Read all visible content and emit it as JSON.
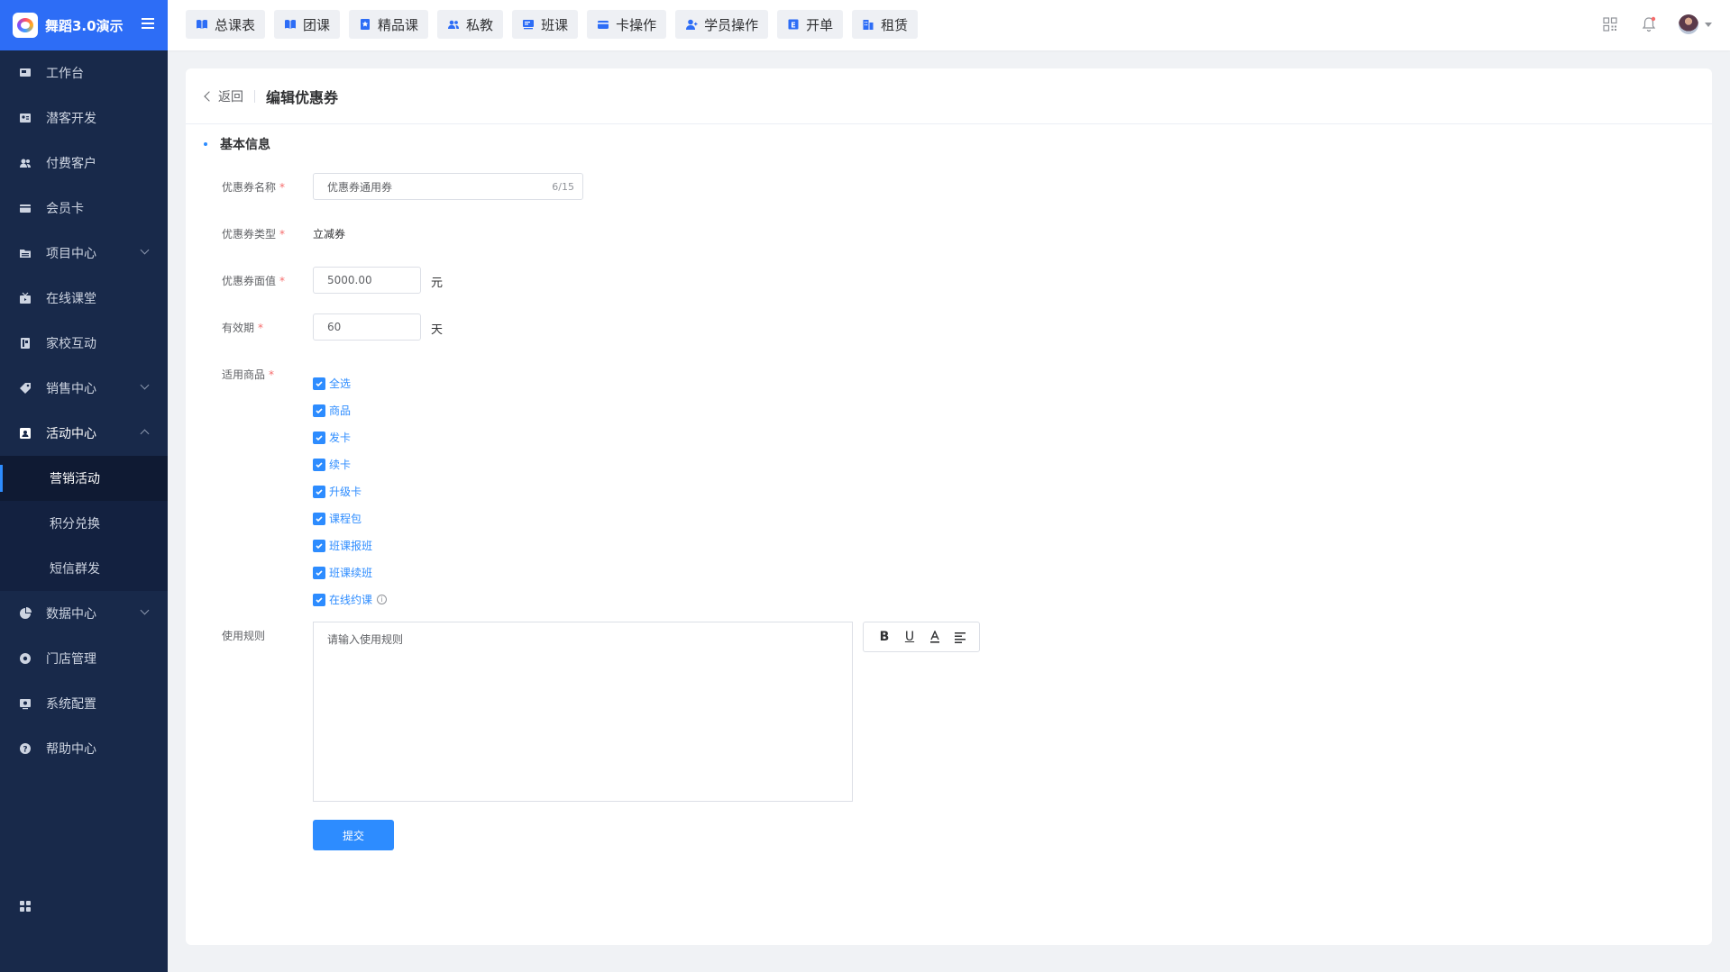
{
  "app": {
    "name": "舞蹈3.0演示"
  },
  "sidebar": {
    "items": [
      {
        "label": "工作台",
        "icon": "monitor-icon"
      },
      {
        "label": "潜客开发",
        "icon": "contact-card-icon"
      },
      {
        "label": "付费客户",
        "icon": "users-icon"
      },
      {
        "label": "会员卡",
        "icon": "card-icon"
      },
      {
        "label": "项目中心",
        "icon": "folder-icon"
      },
      {
        "label": "在线课堂",
        "icon": "tv-icon"
      },
      {
        "label": "家校互动",
        "icon": "book-icon"
      },
      {
        "label": "销售中心",
        "icon": "tag-icon"
      },
      {
        "label": "活动中心",
        "icon": "activity-icon"
      },
      {
        "label": "营销活动"
      },
      {
        "label": "积分兑换"
      },
      {
        "label": "短信群发"
      },
      {
        "label": "数据中心",
        "icon": "pie-chart-icon"
      },
      {
        "label": "门店管理",
        "icon": "store-icon"
      },
      {
        "label": "系统配置",
        "icon": "settings-icon"
      },
      {
        "label": "帮助中心",
        "icon": "help-icon"
      }
    ]
  },
  "topbar": {
    "tabs": [
      {
        "label": "总课表",
        "icon": "book-open-icon"
      },
      {
        "label": "团课",
        "icon": "book-open-icon"
      },
      {
        "label": "精品课",
        "icon": "star-book-icon"
      },
      {
        "label": "私教",
        "icon": "users-icon"
      },
      {
        "label": "班课",
        "icon": "board-icon"
      },
      {
        "label": "卡操作",
        "icon": "card-icon"
      },
      {
        "label": "学员操作",
        "icon": "user-icon"
      },
      {
        "label": "开单",
        "icon": "receipt-icon"
      },
      {
        "label": "租赁",
        "icon": "building-icon"
      }
    ]
  },
  "page": {
    "back_label": "返回",
    "title": "编辑优惠券",
    "section_title": "基本信息"
  },
  "form": {
    "name": {
      "label": "优惠券名称",
      "value": "优惠券通用券",
      "counter": "6/15"
    },
    "type": {
      "label": "优惠券类型",
      "value": "立减券"
    },
    "face_value": {
      "label": "优惠券面值",
      "value": "5000.00",
      "unit": "元"
    },
    "validity": {
      "label": "有效期",
      "value": "60",
      "unit": "天"
    },
    "products": {
      "label": "适用商品",
      "options": [
        "全选",
        "商品",
        "发卡",
        "续卡",
        "升级卡",
        "课程包",
        "班课报班",
        "班课续班",
        "在线约课"
      ]
    },
    "rules": {
      "label": "使用规则",
      "placeholder": "请输入使用规则"
    },
    "required_mark": "*",
    "submit_label": "提交"
  },
  "colors": {
    "primary": "#2d8cff",
    "sidebar_bg": "#18294a",
    "brand_bg": "#2d6df6",
    "required": "#f56c6c"
  }
}
